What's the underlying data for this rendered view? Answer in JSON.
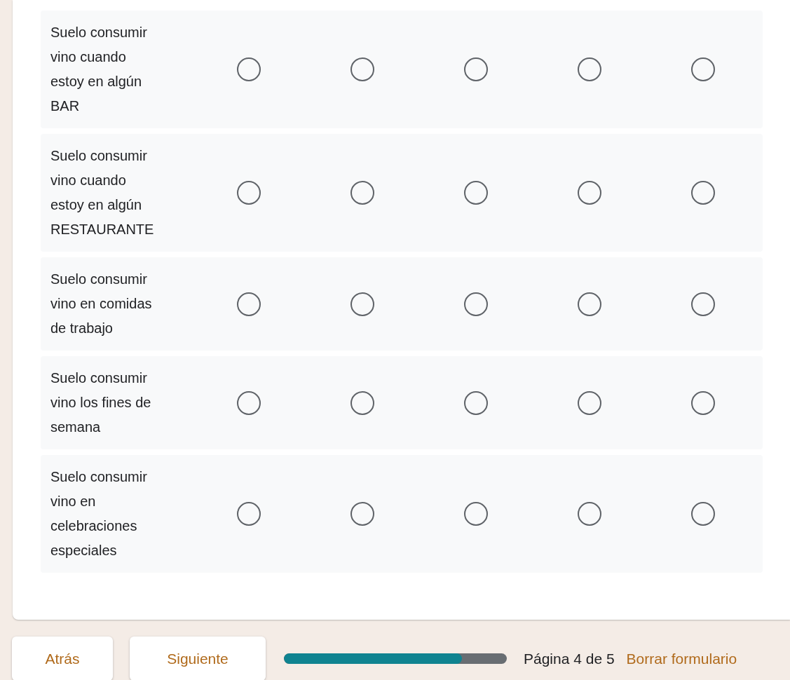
{
  "grid": {
    "rows": [
      {
        "label": "Suelo consumir vino cuando estoy en algún BAR",
        "options": [
          {
            "selected": false
          },
          {
            "selected": false
          },
          {
            "selected": false
          },
          {
            "selected": false
          },
          {
            "selected": false
          }
        ]
      },
      {
        "label": "Suelo consumir vino cuando estoy en algún RESTAURANTE",
        "options": [
          {
            "selected": false
          },
          {
            "selected": false
          },
          {
            "selected": false
          },
          {
            "selected": false
          },
          {
            "selected": false
          }
        ]
      },
      {
        "label": "Suelo consumir vino en comidas de trabajo",
        "options": [
          {
            "selected": false
          },
          {
            "selected": false
          },
          {
            "selected": false
          },
          {
            "selected": false
          },
          {
            "selected": false
          }
        ]
      },
      {
        "label": "Suelo consumir vino los fines de semana",
        "options": [
          {
            "selected": false
          },
          {
            "selected": false
          },
          {
            "selected": false
          },
          {
            "selected": false
          },
          {
            "selected": false
          }
        ]
      },
      {
        "label": "Suelo consumir vino en celebraciones especiales",
        "options": [
          {
            "selected": false
          },
          {
            "selected": false
          },
          {
            "selected": false
          },
          {
            "selected": false
          },
          {
            "selected": false
          }
        ]
      }
    ]
  },
  "footer": {
    "buttons": [
      {
        "label": "Atrás"
      },
      {
        "label": "Siguiente"
      }
    ],
    "progress": {
      "level": 0.8
    },
    "page_text": "Página 4 de 5",
    "clear_link": "Borrar formulario"
  }
}
